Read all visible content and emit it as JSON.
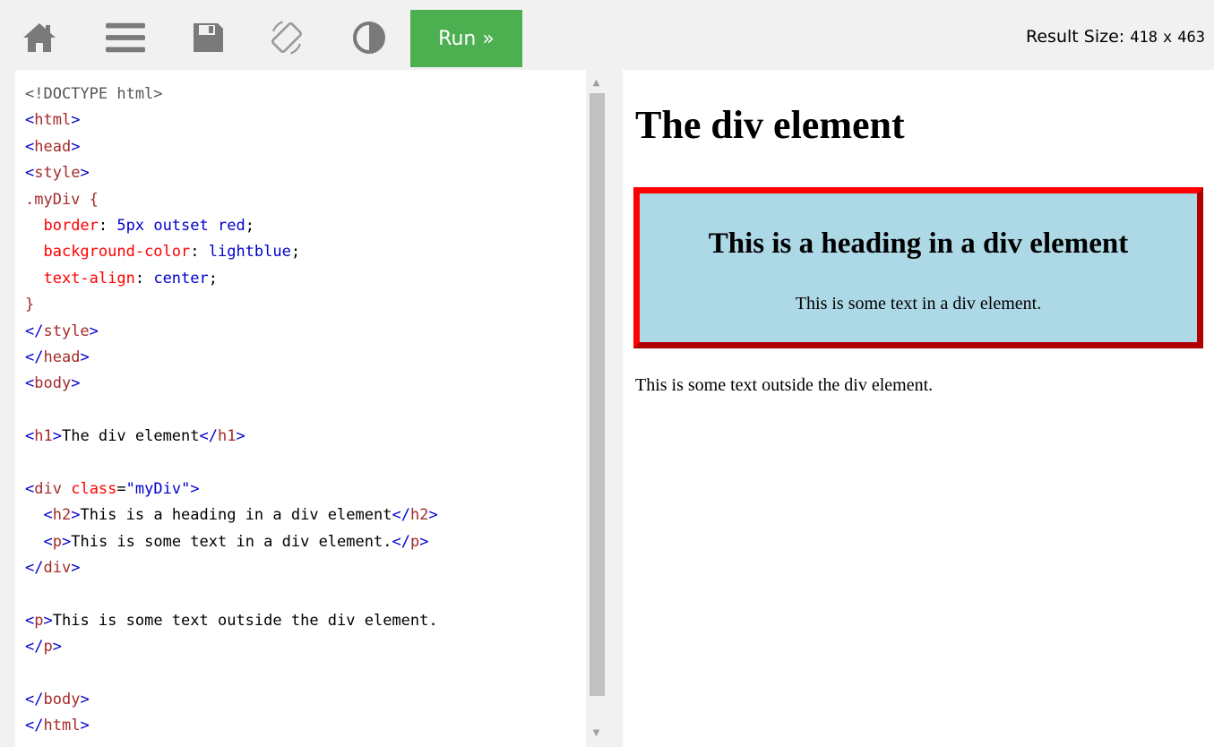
{
  "toolbar": {
    "icons": [
      "home-icon",
      "menu-icon",
      "save-icon",
      "rotate-icon",
      "contrast-icon"
    ],
    "run_label": "Run »",
    "result_size_label": "Result Size:",
    "result_width": "418",
    "result_x": "x",
    "result_height": "463"
  },
  "colors": {
    "run_button": "#4caf50",
    "toolbar_bg": "#f1f1f1",
    "icon": "#7a7a7a",
    "tag": "#a52a2a",
    "bracket": "#0000cd",
    "attr": "#ff0000",
    "value": "#0000cd",
    "div_background": "#add8e6",
    "div_border": "#ff0000"
  },
  "editor": {
    "lines": [
      [
        {
          "t": "<!DOCTYPE html>",
          "c": "doc"
        }
      ],
      [
        {
          "t": "<",
          "c": "brk"
        },
        {
          "t": "html",
          "c": "tag"
        },
        {
          "t": ">",
          "c": "brk"
        }
      ],
      [
        {
          "t": "<",
          "c": "brk"
        },
        {
          "t": "head",
          "c": "tag"
        },
        {
          "t": ">",
          "c": "brk"
        }
      ],
      [
        {
          "t": "<",
          "c": "brk"
        },
        {
          "t": "style",
          "c": "tag"
        },
        {
          "t": ">",
          "c": "brk"
        }
      ],
      [
        {
          "t": ".myDiv {",
          "c": "sel"
        }
      ],
      [
        {
          "t": "  ",
          "c": ""
        },
        {
          "t": "border",
          "c": "prop"
        },
        {
          "t": ": ",
          "c": ""
        },
        {
          "t": "5px outset red",
          "c": "pv"
        },
        {
          "t": ";",
          "c": ""
        }
      ],
      [
        {
          "t": "  ",
          "c": ""
        },
        {
          "t": "background-color",
          "c": "prop"
        },
        {
          "t": ": ",
          "c": ""
        },
        {
          "t": "lightblue",
          "c": "pv"
        },
        {
          "t": ";",
          "c": ""
        }
      ],
      [
        {
          "t": "  ",
          "c": ""
        },
        {
          "t": "text-align",
          "c": "prop"
        },
        {
          "t": ": ",
          "c": ""
        },
        {
          "t": "center",
          "c": "pv"
        },
        {
          "t": ";",
          "c": ""
        }
      ],
      [
        {
          "t": "}",
          "c": "sel"
        }
      ],
      [
        {
          "t": "</",
          "c": "brk"
        },
        {
          "t": "style",
          "c": "tag"
        },
        {
          "t": ">",
          "c": "brk"
        }
      ],
      [
        {
          "t": "</",
          "c": "brk"
        },
        {
          "t": "head",
          "c": "tag"
        },
        {
          "t": ">",
          "c": "brk"
        }
      ],
      [
        {
          "t": "<",
          "c": "brk"
        },
        {
          "t": "body",
          "c": "tag"
        },
        {
          "t": ">",
          "c": "brk"
        }
      ],
      [],
      [
        {
          "t": "<",
          "c": "brk"
        },
        {
          "t": "h1",
          "c": "tag"
        },
        {
          "t": ">",
          "c": "brk"
        },
        {
          "t": "The div element",
          "c": ""
        },
        {
          "t": "</",
          "c": "brk"
        },
        {
          "t": "h1",
          "c": "tag"
        },
        {
          "t": ">",
          "c": "brk"
        }
      ],
      [],
      [
        {
          "t": "<",
          "c": "brk"
        },
        {
          "t": "div",
          "c": "tag"
        },
        {
          "t": " ",
          "c": ""
        },
        {
          "t": "class",
          "c": "attr"
        },
        {
          "t": "=",
          "c": ""
        },
        {
          "t": "\"myDiv\"",
          "c": "val"
        },
        {
          "t": ">",
          "c": "brk"
        }
      ],
      [
        {
          "t": "  ",
          "c": ""
        },
        {
          "t": "<",
          "c": "brk"
        },
        {
          "t": "h2",
          "c": "tag"
        },
        {
          "t": ">",
          "c": "brk"
        },
        {
          "t": "This is a heading in a div element",
          "c": ""
        },
        {
          "t": "</",
          "c": "brk"
        },
        {
          "t": "h2",
          "c": "tag"
        },
        {
          "t": ">",
          "c": "brk"
        }
      ],
      [
        {
          "t": "  ",
          "c": ""
        },
        {
          "t": "<",
          "c": "brk"
        },
        {
          "t": "p",
          "c": "tag"
        },
        {
          "t": ">",
          "c": "brk"
        },
        {
          "t": "This is some text in a div element.",
          "c": ""
        },
        {
          "t": "</",
          "c": "brk"
        },
        {
          "t": "p",
          "c": "tag"
        },
        {
          "t": ">",
          "c": "brk"
        }
      ],
      [
        {
          "t": "</",
          "c": "brk"
        },
        {
          "t": "div",
          "c": "tag"
        },
        {
          "t": ">",
          "c": "brk"
        }
      ],
      [],
      [
        {
          "t": "<",
          "c": "brk"
        },
        {
          "t": "p",
          "c": "tag"
        },
        {
          "t": ">",
          "c": "brk"
        },
        {
          "t": "This is some text outside the div element.",
          "c": ""
        }
      ],
      [
        {
          "t": "</",
          "c": "brk"
        },
        {
          "t": "p",
          "c": "tag"
        },
        {
          "t": ">",
          "c": "brk"
        }
      ],
      [],
      [
        {
          "t": "</",
          "c": "brk"
        },
        {
          "t": "body",
          "c": "tag"
        },
        {
          "t": ">",
          "c": "brk"
        }
      ],
      [
        {
          "t": "</",
          "c": "brk"
        },
        {
          "t": "html",
          "c": "tag"
        },
        {
          "t": ">",
          "c": "brk"
        }
      ]
    ]
  },
  "result": {
    "h1": "The div element",
    "h2": "This is a heading in a div element",
    "p_inside": "This is some text in a div element.",
    "p_outside": "This is some text outside the div element."
  }
}
